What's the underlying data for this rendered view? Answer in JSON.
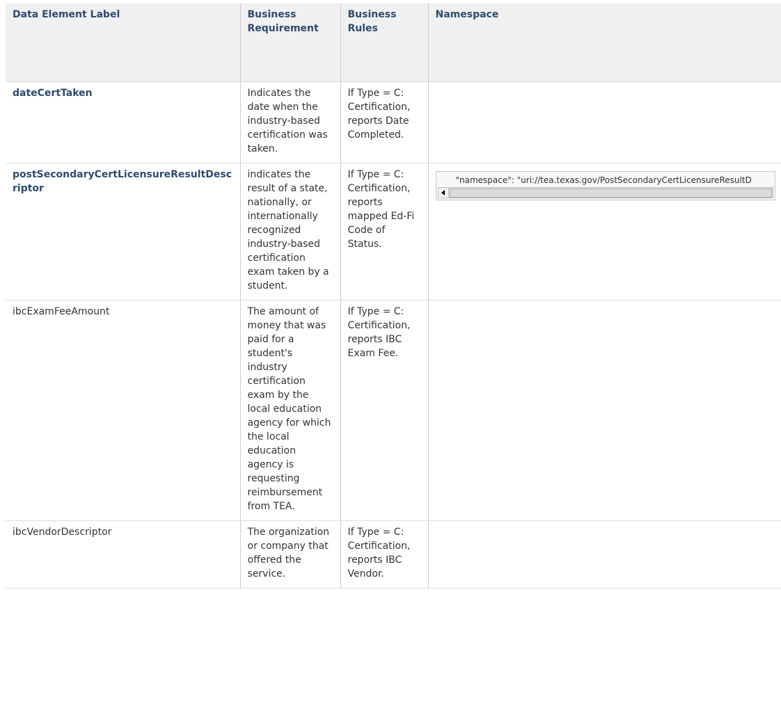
{
  "headers": {
    "label": "Data Element Label",
    "requirement": "Business Requirement",
    "rules": "Business Rules",
    "namespace": "Namespace"
  },
  "rows": [
    {
      "label": "dateCertTaken",
      "requirement": "Indicates the date when the industry-based certification was taken.",
      "rules": "If Type = C: Certification, reports Date Completed.",
      "namespace": ""
    },
    {
      "label": "postSecondaryCertLicensureResultDescriptor",
      "requirement": "indicates the result of a state, nationally, or internationally recognized industry-based certification exam taken by a student.",
      "rules": "If Type = C: Certification, reports mapped Ed-Fi Code of Status.",
      "namespace": "\"namespace\": \"uri://tea.texas.gov/PostSecondaryCertLicensureResultD"
    },
    {
      "label": "ibcExamFeeAmount",
      "requirement": "The amount of money that was paid for a student's industry certification exam by the local education agency for which the local education agency is requesting reimbursement from TEA.",
      "rules": "If Type = C: Certification, reports IBC Exam Fee.",
      "namespace": ""
    },
    {
      "label": "ibcVendorDescriptor",
      "requirement": "The organization or company that offered the service.",
      "rules": "If Type = C: Certification, reports IBC Vendor.",
      "namespace": ""
    }
  ]
}
